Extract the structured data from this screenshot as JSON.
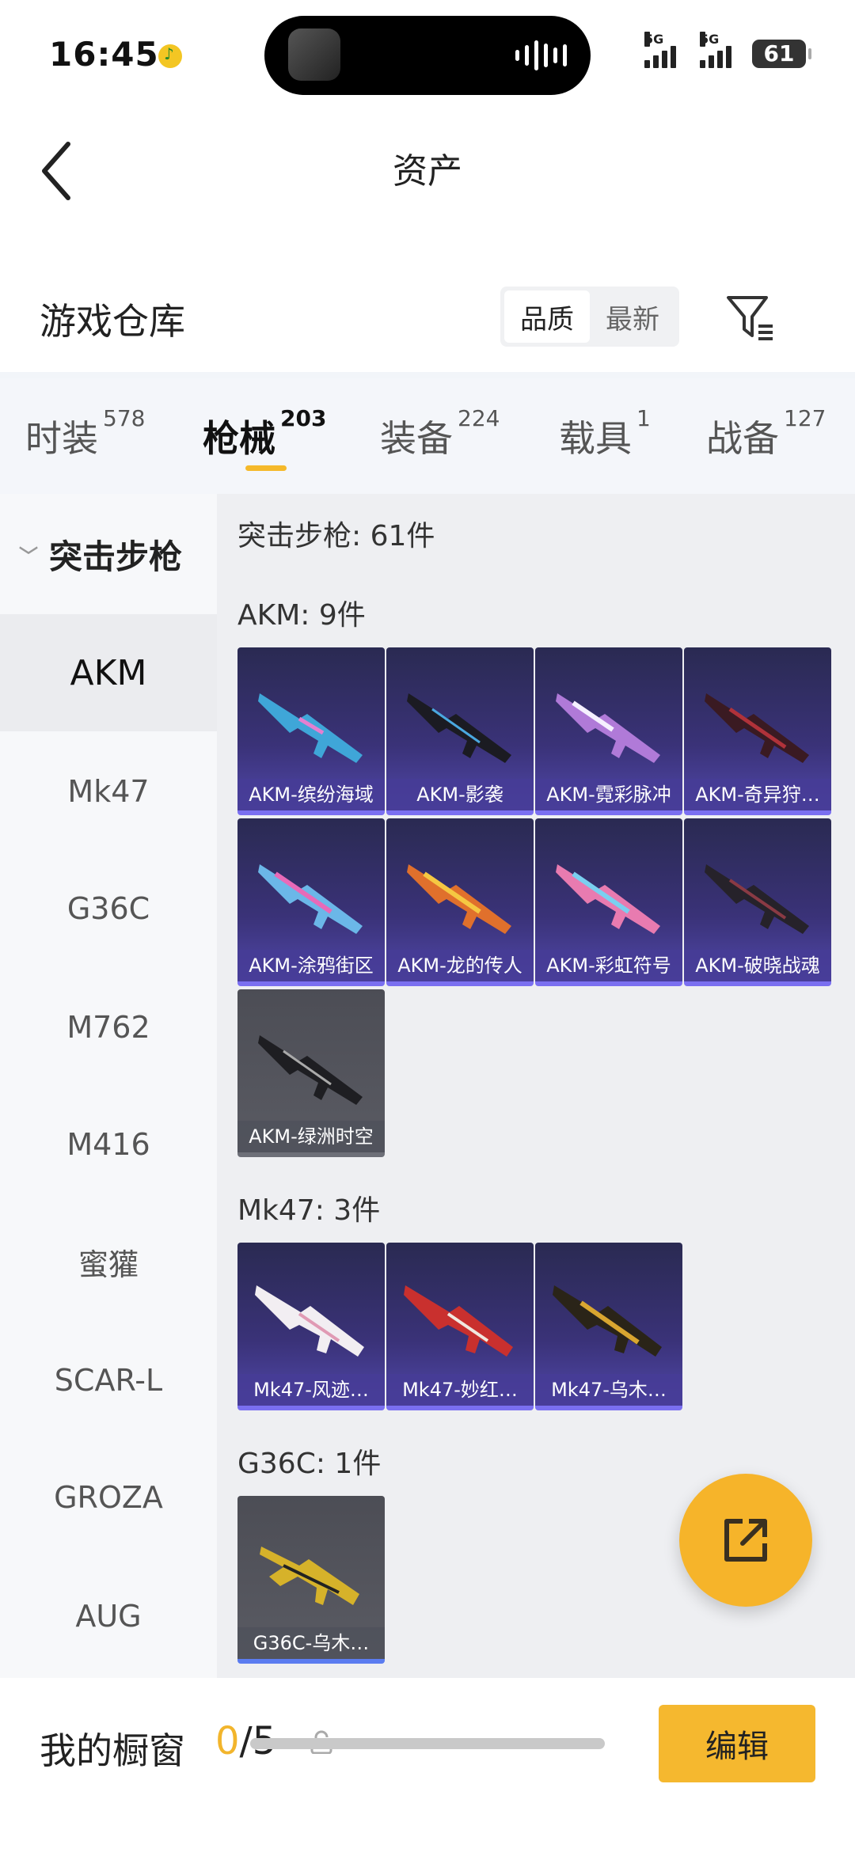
{
  "status": {
    "time": "16:45",
    "signal1": "5G",
    "signal2": "5G",
    "battery": "61"
  },
  "header": {
    "title": "资产",
    "section_title": "游戏仓库",
    "sort_quality": "品质",
    "sort_newest": "最新"
  },
  "tabs": [
    {
      "label": "时装",
      "count": "578"
    },
    {
      "label": "枪械",
      "count": "203"
    },
    {
      "label": "装备",
      "count": "224"
    },
    {
      "label": "载具",
      "count": "1"
    },
    {
      "label": "战备",
      "count": "127"
    }
  ],
  "sidebar": {
    "group": "突击步枪",
    "items": [
      "AKM",
      "Mk47",
      "G36C",
      "M762",
      "M416",
      "蜜獾",
      "SCAR-L",
      "GROZA",
      "AUG"
    ]
  },
  "content": {
    "category_total": "突击步枪: 61件",
    "groups": [
      {
        "title": "AKM: 9件",
        "items": [
          "AKM-缤纷海域",
          "AKM-影袭",
          "AKM-霓彩脉冲",
          "AKM-奇异狩…",
          "AKM-涂鸦街区",
          "AKM-龙的传人",
          "AKM-彩虹符号",
          "AKM-破晓战魂",
          "AKM-绿洲时空"
        ]
      },
      {
        "title": "Mk47: 3件",
        "items": [
          "Mk47-风迹…",
          "Mk47-妙红…",
          "Mk47-乌木…"
        ]
      },
      {
        "title": "G36C: 1件",
        "items": [
          "G36C-乌木…"
        ]
      }
    ]
  },
  "bottom": {
    "showcase_label": "我的橱窗",
    "showcase_current": "0",
    "showcase_total": "/5",
    "edit_label": "编辑"
  },
  "colors": {
    "accent": "#f5b82f",
    "card_purple": "#3a3278",
    "card_grey": "#55565e"
  }
}
